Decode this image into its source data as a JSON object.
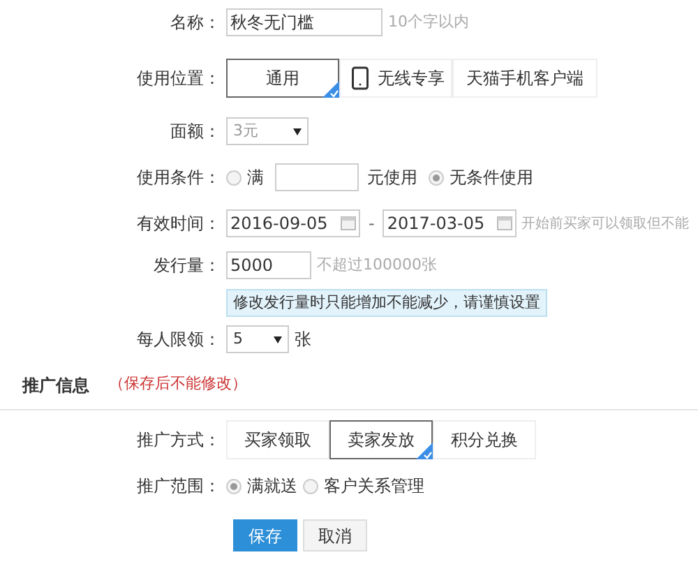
{
  "name": {
    "label": "名称：",
    "value": "秋冬无门槛",
    "hint": "10个字以内"
  },
  "position": {
    "label": "使用位置：",
    "options": [
      {
        "label": "通用",
        "selected": true
      },
      {
        "label": "无线专享",
        "selected": false,
        "kind": "phone"
      },
      {
        "label": "天猫手机客户端",
        "selected": false
      }
    ]
  },
  "denomination": {
    "label": "面额：",
    "value": "3元"
  },
  "condition": {
    "label": "使用条件：",
    "options": [
      {
        "label": "满",
        "selected": false,
        "suffix": "元使用"
      },
      {
        "label": "无条件使用",
        "selected": true
      }
    ]
  },
  "validity": {
    "label": "有效时间：",
    "start": "2016-09-05",
    "separator": "-",
    "end": "2017-03-05",
    "hint": "开始前买家可以领取但不能"
  },
  "issue": {
    "label": "发行量：",
    "value": "5000",
    "hint": "不超过100000张",
    "tip": "修改发行量时只能增加不能减少，请谨慎设置"
  },
  "limit": {
    "label": "每人限领：",
    "value": "5",
    "unit": "张"
  },
  "section": {
    "title": "推广信息",
    "note": "（保存后不能修改）"
  },
  "method": {
    "label": "推广方式：",
    "options": [
      {
        "label": "买家领取",
        "selected": false
      },
      {
        "label": "卖家发放",
        "selected": true
      },
      {
        "label": "积分兑换",
        "selected": false
      }
    ]
  },
  "scope": {
    "label": "推广范围：",
    "options": [
      {
        "label": "满就送",
        "selected": true
      },
      {
        "label": "客户关系管理",
        "selected": false
      }
    ]
  },
  "buttons": [
    {
      "label": "保存",
      "kind": "primary"
    },
    {
      "label": "取消",
      "kind": "secondary"
    }
  ]
}
